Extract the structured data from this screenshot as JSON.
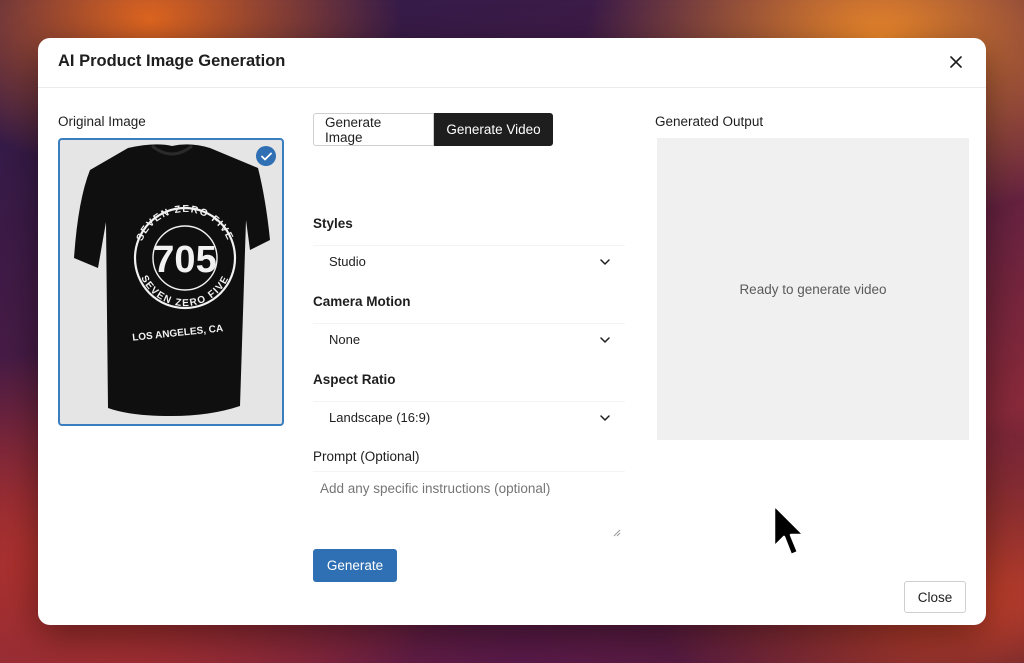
{
  "modal": {
    "title": "AI Product Image Generation",
    "close_icon": "close-icon"
  },
  "original_image": {
    "label": "Original Image",
    "selected": true,
    "tshirt_print": {
      "ring_text_top": "SEVEN ZERO FIVE",
      "ring_text_bottom": "SEVEN ZERO FIVE",
      "number": "705",
      "location": "LOS ANGELES, CA"
    }
  },
  "tabs": [
    {
      "label": "Generate Image",
      "active": false
    },
    {
      "label": "Generate Video",
      "active": true
    }
  ],
  "form": {
    "styles": {
      "label": "Styles",
      "value": "Studio"
    },
    "camera_motion": {
      "label": "Camera Motion",
      "value": "None"
    },
    "aspect_ratio": {
      "label": "Aspect Ratio",
      "value": "Landscape (16:9)"
    },
    "prompt": {
      "label": "Prompt (Optional)",
      "placeholder": "Add any specific instructions (optional)"
    },
    "generate_label": "Generate"
  },
  "output": {
    "label": "Generated Output",
    "status": "Ready to generate video"
  },
  "footer": {
    "close_label": "Close"
  },
  "colors": {
    "primary": "#2f6fb3",
    "active_tab": "#1e1e1e",
    "output_bg": "#f0f0f0"
  }
}
